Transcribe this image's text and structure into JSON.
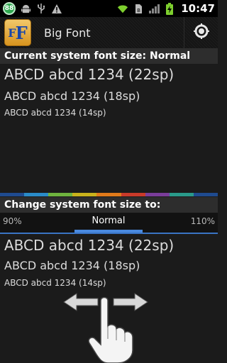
{
  "status_bar": {
    "notification_badge": "88",
    "time": "10:47",
    "icons": [
      "notification-badge-icon",
      "android-icon",
      "usb-icon",
      "warning-icon",
      "wifi-icon",
      "sim-icon",
      "signal-icon",
      "battery-charging-icon"
    ]
  },
  "action_bar": {
    "title": "Big Font",
    "app_icon_text_small": "F",
    "app_icon_text_big": "F",
    "action_icon": "settings-dial-icon"
  },
  "current_section": {
    "header": "Current system font size: Normal",
    "samples": [
      "ABCD abcd 1234 (22sp)",
      "ABCD abcd 1234 (18sp)",
      "ABCD abcd 1234 (14sp)"
    ]
  },
  "color_strip": [
    "#1f4b8f",
    "#2a8bc8",
    "#6fb33e",
    "#c9b21c",
    "#e07a1a",
    "#c93a2a",
    "#7a3d9a",
    "#2a9a8a",
    "#1f4b8f"
  ],
  "change_section": {
    "header": "Change system font size to:",
    "left_option": "90%",
    "selected_option": "Normal",
    "right_option": "110%",
    "samples": [
      "ABCD abcd 1234 (22sp)",
      "ABCD abcd 1234 (18sp)",
      "ABCD abcd 1234 (14sp)"
    ]
  },
  "gesture_hint": "swipe-hand-icon"
}
